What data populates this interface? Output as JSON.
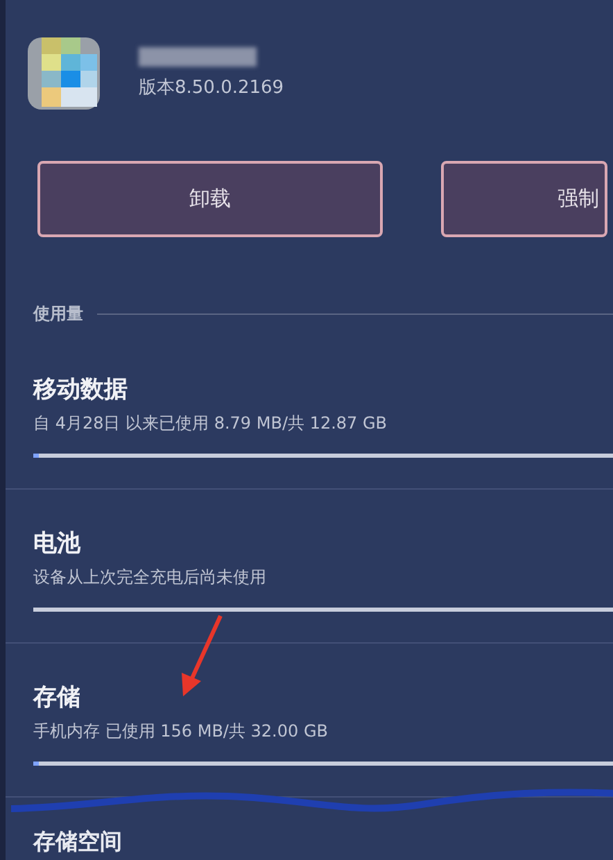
{
  "app": {
    "version": "版本8.50.0.2169"
  },
  "buttons": [
    {
      "label": "卸载"
    },
    {
      "label": "强制"
    }
  ],
  "section": {
    "title": "使用量"
  },
  "items": [
    {
      "title": "移动数据",
      "subtitle": "自 4月28日 以来已使用 8.79 MB/共 12.87 GB",
      "level": 0.01
    },
    {
      "title": "电池",
      "subtitle": "设备从上次完全充电后尚未使用"
    },
    {
      "title": "存储",
      "subtitle": "手机内存 已使用 156 MB/共 32.00 GB",
      "level": 0.01
    }
  ],
  "next_item": {
    "title": "存储空间"
  }
}
